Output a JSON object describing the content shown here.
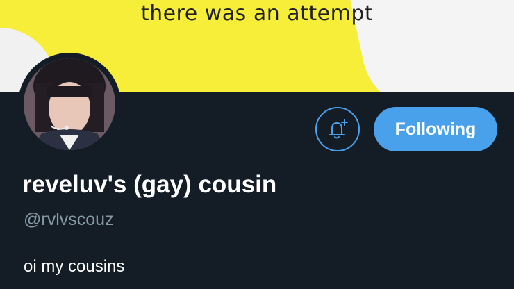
{
  "banner": {
    "caption": "there was an attempt"
  },
  "profile": {
    "display_name": "reveluv's (gay) cousin",
    "handle": "@rvlvscouz",
    "bio": "oi my cousins"
  },
  "actions": {
    "notify_icon": "bell-plus-icon",
    "following_label": "Following"
  },
  "colors": {
    "background": "#141d26",
    "accent": "#4aa1eb",
    "handle": "#8899a6",
    "banner": "#f7ee3a"
  }
}
